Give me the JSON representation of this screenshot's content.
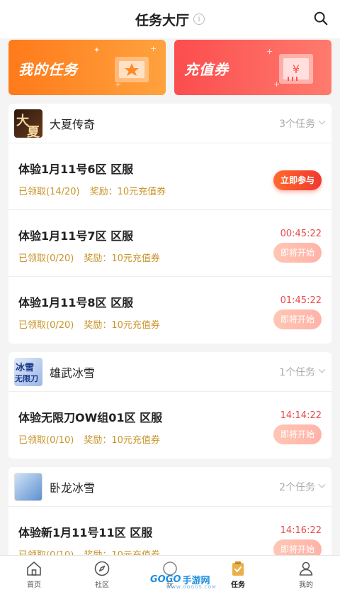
{
  "header": {
    "title": "任务大厅",
    "info_glyph": "i"
  },
  "banners": {
    "my_tasks": "我的任务",
    "recharge": "充值券"
  },
  "games": [
    {
      "name": "大夏传奇",
      "count": "3个任务",
      "logo_text": [
        "大",
        "夏"
      ],
      "tasks": [
        {
          "title": "体验1月11号6区 区服",
          "claimed": "已领取(14/20)",
          "reward": "奖励：10元充值券",
          "button": "立即参与"
        },
        {
          "title": "体验1月11号7区 区服",
          "claimed": "已领取(0/20)",
          "reward": "奖励：10元充值券",
          "countdown": "00:45:22",
          "button": "即将开始"
        },
        {
          "title": "体验1月11号8区 区服",
          "claimed": "已领取(0/20)",
          "reward": "奖励：10元充值券",
          "countdown": "01:45:22",
          "button": "即将开始"
        }
      ]
    },
    {
      "name": "雄武冰雪",
      "count": "1个任务",
      "logo_text": [
        "冰雪",
        "无限刀"
      ],
      "tasks": [
        {
          "title": "体验无限刀OW组01区 区服",
          "claimed": "已领取(0/10)",
          "reward": "奖励：10元充值券",
          "countdown": "14:14:22",
          "button": "即将开始"
        }
      ]
    },
    {
      "name": "卧龙冰雪",
      "count": "2个任务",
      "tasks": [
        {
          "title": "体验新1月11号11区 区服",
          "claimed": "已领取(0/10)",
          "reward": "奖励：10元充值券",
          "countdown": "14:16:22",
          "button": "即将开始"
        }
      ]
    }
  ],
  "tabbar": {
    "home": "首页",
    "community": "社区",
    "play": "玩",
    "tasks": "任务",
    "mine": "我的"
  },
  "watermark": {
    "brand": "GOGO",
    "suffix": "手游网",
    "sub": "WWW.GOGOS.COM"
  },
  "colors": {
    "accent": "#e84a4a",
    "gold": "#c9942a",
    "orange": "#ff7a1a"
  }
}
